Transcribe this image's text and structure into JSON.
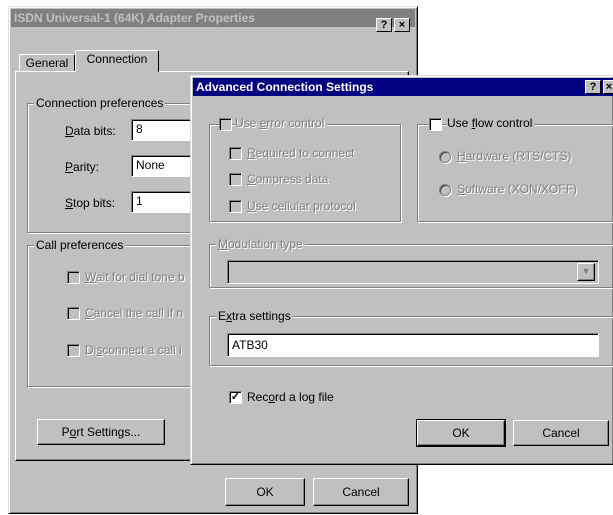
{
  "main_dialog": {
    "title": "ISDN Universal-1 (64K) Adapter Properties",
    "help_btn": "?",
    "close_btn": "×",
    "tabs": [
      {
        "label": "General"
      },
      {
        "label": "Connection"
      }
    ],
    "conn_prefs": {
      "legend": "Connection preferences",
      "data_bits_label_u": "D",
      "data_bits_label_rest": "ata bits:",
      "data_bits_value": "8",
      "parity_label_u": "P",
      "parity_label_rest": "arity:",
      "parity_value": "None",
      "stop_bits_label_u": "S",
      "stop_bits_label_rest": "top bits:",
      "stop_bits_value": "1"
    },
    "call_prefs": {
      "legend": "Call preferences",
      "wait_u": "W",
      "wait_rest": "ait for dial tone b",
      "cancel_u": "C",
      "cancel_rest": "ancel the call if n",
      "disconnect_pre": "Di",
      "disconnect_u": "s",
      "disconnect_rest": "connect a call i"
    },
    "port_settings_pre": "P",
    "port_settings_u": "o",
    "port_settings_rest": "rt Settings...",
    "ok": "OK",
    "cancel": "Cancel"
  },
  "adv_dialog": {
    "title": "Advanced Connection Settings",
    "help_btn": "?",
    "close_btn": "×",
    "error_control": {
      "legend_pre": "Use ",
      "legend_u": "e",
      "legend_rest": "rror control",
      "required_u": "R",
      "required_rest": "equired to connect",
      "compress_u": "C",
      "compress_rest": "ompress data",
      "cellular_u": "U",
      "cellular_rest": "se cellular protocol"
    },
    "flow_control": {
      "legend_pre": "Use ",
      "legend_u": "f",
      "legend_rest": "low control",
      "hardware_u": "H",
      "hardware_rest": "ardware (RTS/CTS)",
      "software_u": "S",
      "software_rest": "oftware (XON/XOFF)"
    },
    "modulation": {
      "legend_u": "M",
      "legend_rest": "odulation type",
      "value": ""
    },
    "extra": {
      "legend_pre": "E",
      "legend_u": "x",
      "legend_rest": "tra settings",
      "value": "ATB30"
    },
    "record_log": {
      "pre": "Rec",
      "u": "o",
      "rest": "rd a log file",
      "checked": true
    },
    "ok": "OK",
    "cancel": "Cancel"
  }
}
